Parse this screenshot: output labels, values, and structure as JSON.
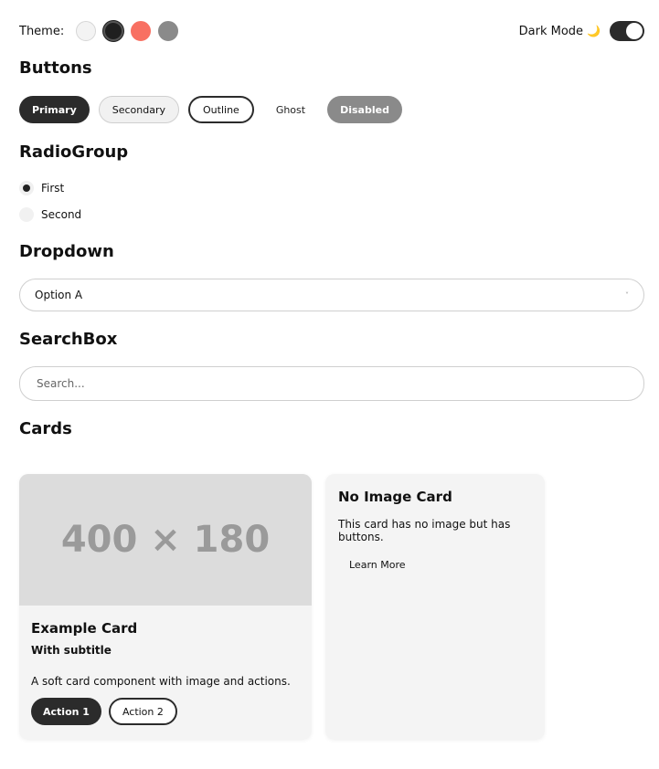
{
  "theme": {
    "label": "Theme:",
    "swatches": [
      {
        "name": "light",
        "color": "#f3f3f3"
      },
      {
        "name": "dark",
        "color": "#1f1f1f",
        "selected": true
      },
      {
        "name": "coral",
        "color": "#f87062"
      },
      {
        "name": "grey",
        "color": "#8a8a8a"
      }
    ]
  },
  "dark_mode": {
    "label": "Dark Mode",
    "icon": "🌙",
    "enabled": true
  },
  "sections": {
    "buttons": "Buttons",
    "radio_group": "RadioGroup",
    "dropdown": "Dropdown",
    "search_box": "SearchBox",
    "cards": "Cards"
  },
  "buttons": {
    "primary": "Primary",
    "secondary": "Secondary",
    "outline": "Outline",
    "ghost": "Ghost",
    "disabled": "Disabled"
  },
  "radio_group": {
    "options": [
      {
        "label": "First",
        "checked": true
      },
      {
        "label": "Second",
        "checked": false
      }
    ]
  },
  "dropdown": {
    "selected": "Option A",
    "caret": "˅"
  },
  "search": {
    "placeholder": "Search..."
  },
  "cards": [
    {
      "image_text": "400 × 180",
      "title": "Example Card",
      "subtitle": "With subtitle",
      "text": "A soft card component with image and actions.",
      "actions": [
        "Action 1",
        "Action 2"
      ]
    },
    {
      "title": "No Image Card",
      "text": "This card has no image but has buttons.",
      "actions": [
        "Learn More"
      ]
    }
  ],
  "colors": {
    "primary": "#2b2b2b",
    "surface": "#f4f4f4",
    "coral": "#f87062",
    "grey": "#8a8a8a"
  }
}
